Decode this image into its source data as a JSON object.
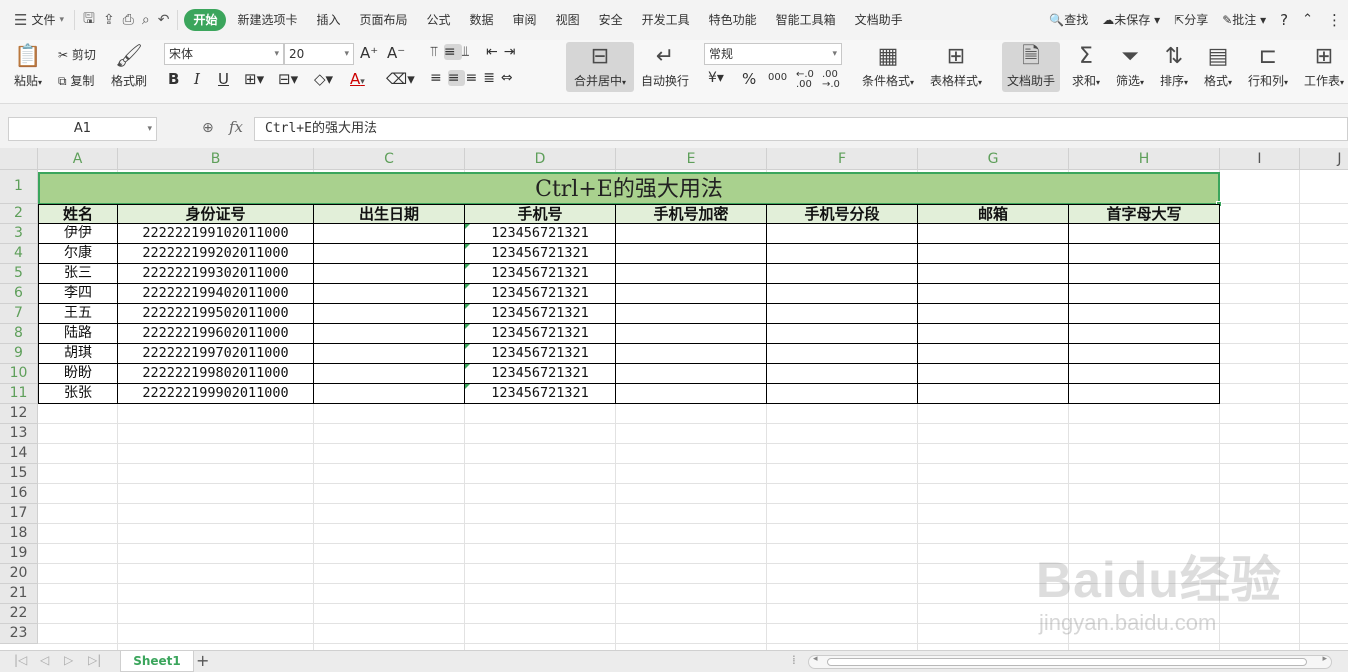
{
  "menubar": {
    "file": "文件",
    "tabs": [
      "开始",
      "新建选项卡",
      "插入",
      "页面布局",
      "公式",
      "数据",
      "审阅",
      "视图",
      "安全",
      "开发工具",
      "特色功能",
      "智能工具箱",
      "文档助手"
    ],
    "active_tab": "开始",
    "search": "查找",
    "unsaved": "未保存",
    "share": "分享",
    "comment": "批注",
    "help": "?"
  },
  "ribbon": {
    "paste": "粘贴",
    "cut": "剪切",
    "copy": "复制",
    "format_painter": "格式刷",
    "font_name": "宋体",
    "font_size": "20",
    "increase_font": "A⁺",
    "decrease_font": "A⁻",
    "bold": "B",
    "italic": "I",
    "underline": "U",
    "merge_center": "合并居中",
    "wrap_text": "自动换行",
    "number_format": "常规",
    "percent": "%",
    "thousands": "000",
    "conditional_format": "条件格式",
    "table_style": "表格样式",
    "doc_assistant": "文档助手",
    "sum": "求和",
    "filter": "筛选",
    "sort": "排序",
    "format": "格式",
    "rows_cols": "行和列",
    "worksheet": "工作表"
  },
  "formula_bar": {
    "name_box": "A1",
    "fx": "fx",
    "formula": "Ctrl+E的强大用法"
  },
  "sheet": {
    "columns": [
      "A",
      "B",
      "C",
      "D",
      "E",
      "F",
      "G",
      "H",
      "I",
      "J"
    ],
    "rows": [
      "1",
      "2",
      "3",
      "4",
      "5",
      "6",
      "7",
      "8",
      "9",
      "10",
      "11",
      "12",
      "13",
      "14",
      "15",
      "16",
      "17",
      "18",
      "19",
      "20",
      "21",
      "22",
      "23"
    ],
    "title": "Ctrl+E的强大用法",
    "headers": [
      "姓名",
      "身份证号",
      "出生日期",
      "手机号",
      "手机号加密",
      "手机号分段",
      "邮箱",
      "首字母大写"
    ],
    "data": [
      [
        "伊伊",
        "222222199102011000",
        "",
        "123456721321",
        "",
        "",
        "",
        ""
      ],
      [
        "尔康",
        "222222199202011000",
        "",
        "123456721321",
        "",
        "",
        "",
        ""
      ],
      [
        "张三",
        "222222199302011000",
        "",
        "123456721321",
        "",
        "",
        "",
        ""
      ],
      [
        "李四",
        "222222199402011000",
        "",
        "123456721321",
        "",
        "",
        "",
        ""
      ],
      [
        "王五",
        "222222199502011000",
        "",
        "123456721321",
        "",
        "",
        "",
        ""
      ],
      [
        "陆路",
        "222222199602011000",
        "",
        "123456721321",
        "",
        "",
        "",
        ""
      ],
      [
        "胡琪",
        "222222199702011000",
        "",
        "123456721321",
        "",
        "",
        "",
        ""
      ],
      [
        "盼盼",
        "222222199802011000",
        "",
        "123456721321",
        "",
        "",
        "",
        ""
      ],
      [
        "张张",
        "222222199902011000",
        "",
        "123456721321",
        "",
        "",
        "",
        ""
      ]
    ]
  },
  "tabs": {
    "sheet_name": "Sheet1",
    "add": "+"
  },
  "watermark": {
    "logo": "Baidu经验",
    "url": "jingyan.baidu.com"
  },
  "colors": {
    "accent": "#3ba55c",
    "title_fill": "#a9d18e",
    "header_fill": "#e2efd9"
  }
}
